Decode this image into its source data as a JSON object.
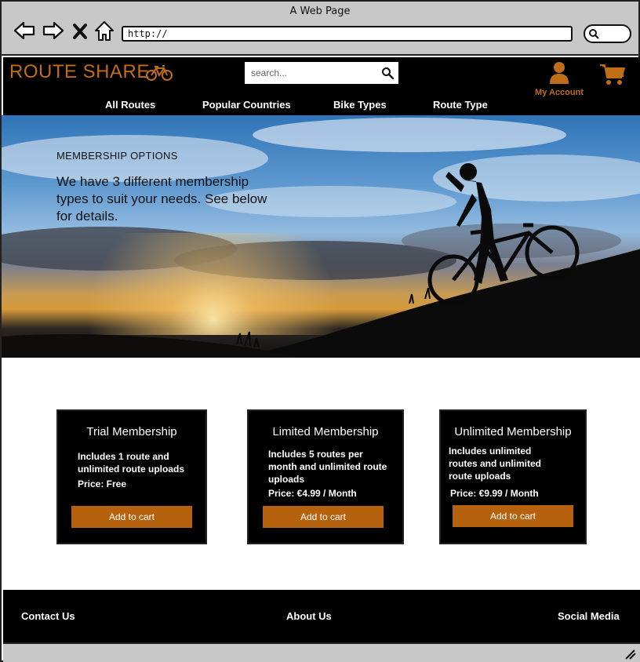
{
  "browser": {
    "window_title": "A Web Page",
    "url": "http://",
    "icons": [
      "back-arrow-icon",
      "forward-arrow-icon",
      "close-icon",
      "home-icon",
      "search-icon"
    ]
  },
  "header": {
    "logo_text": "ROUTE SHARE",
    "logo_icon": "bicycle-icon",
    "search_placeholder": "search...",
    "account_label": "My Account",
    "nav": [
      "All Routes",
      "Popular Countries",
      "Bike Types",
      "Route Type"
    ],
    "colors": {
      "accent": "#c06d1a",
      "background": "#000000"
    }
  },
  "hero": {
    "eyebrow": "MEMBERSHIP OPTIONS",
    "text": "We have 3 different membership types to suit your needs. See below for details."
  },
  "memberships": [
    {
      "title": "Trial Membership",
      "description": "Includes 1 route and unlimited route uploads",
      "price": "Price: Free",
      "button": "Add to cart"
    },
    {
      "title": "Limited Membership",
      "description": "Includes 5 routes per month and unlimited route uploads",
      "price": "Price: €4.99 / Month",
      "button": "Add to cart"
    },
    {
      "title": "Unlimited Membership",
      "description": "Includes unlimited routes and unlimited route uploads",
      "price": "Price: €9.99 / Month",
      "button": "Add to cart"
    }
  ],
  "footer": {
    "contact": "Contact Us",
    "about": "About Us",
    "social": "Social Media"
  }
}
